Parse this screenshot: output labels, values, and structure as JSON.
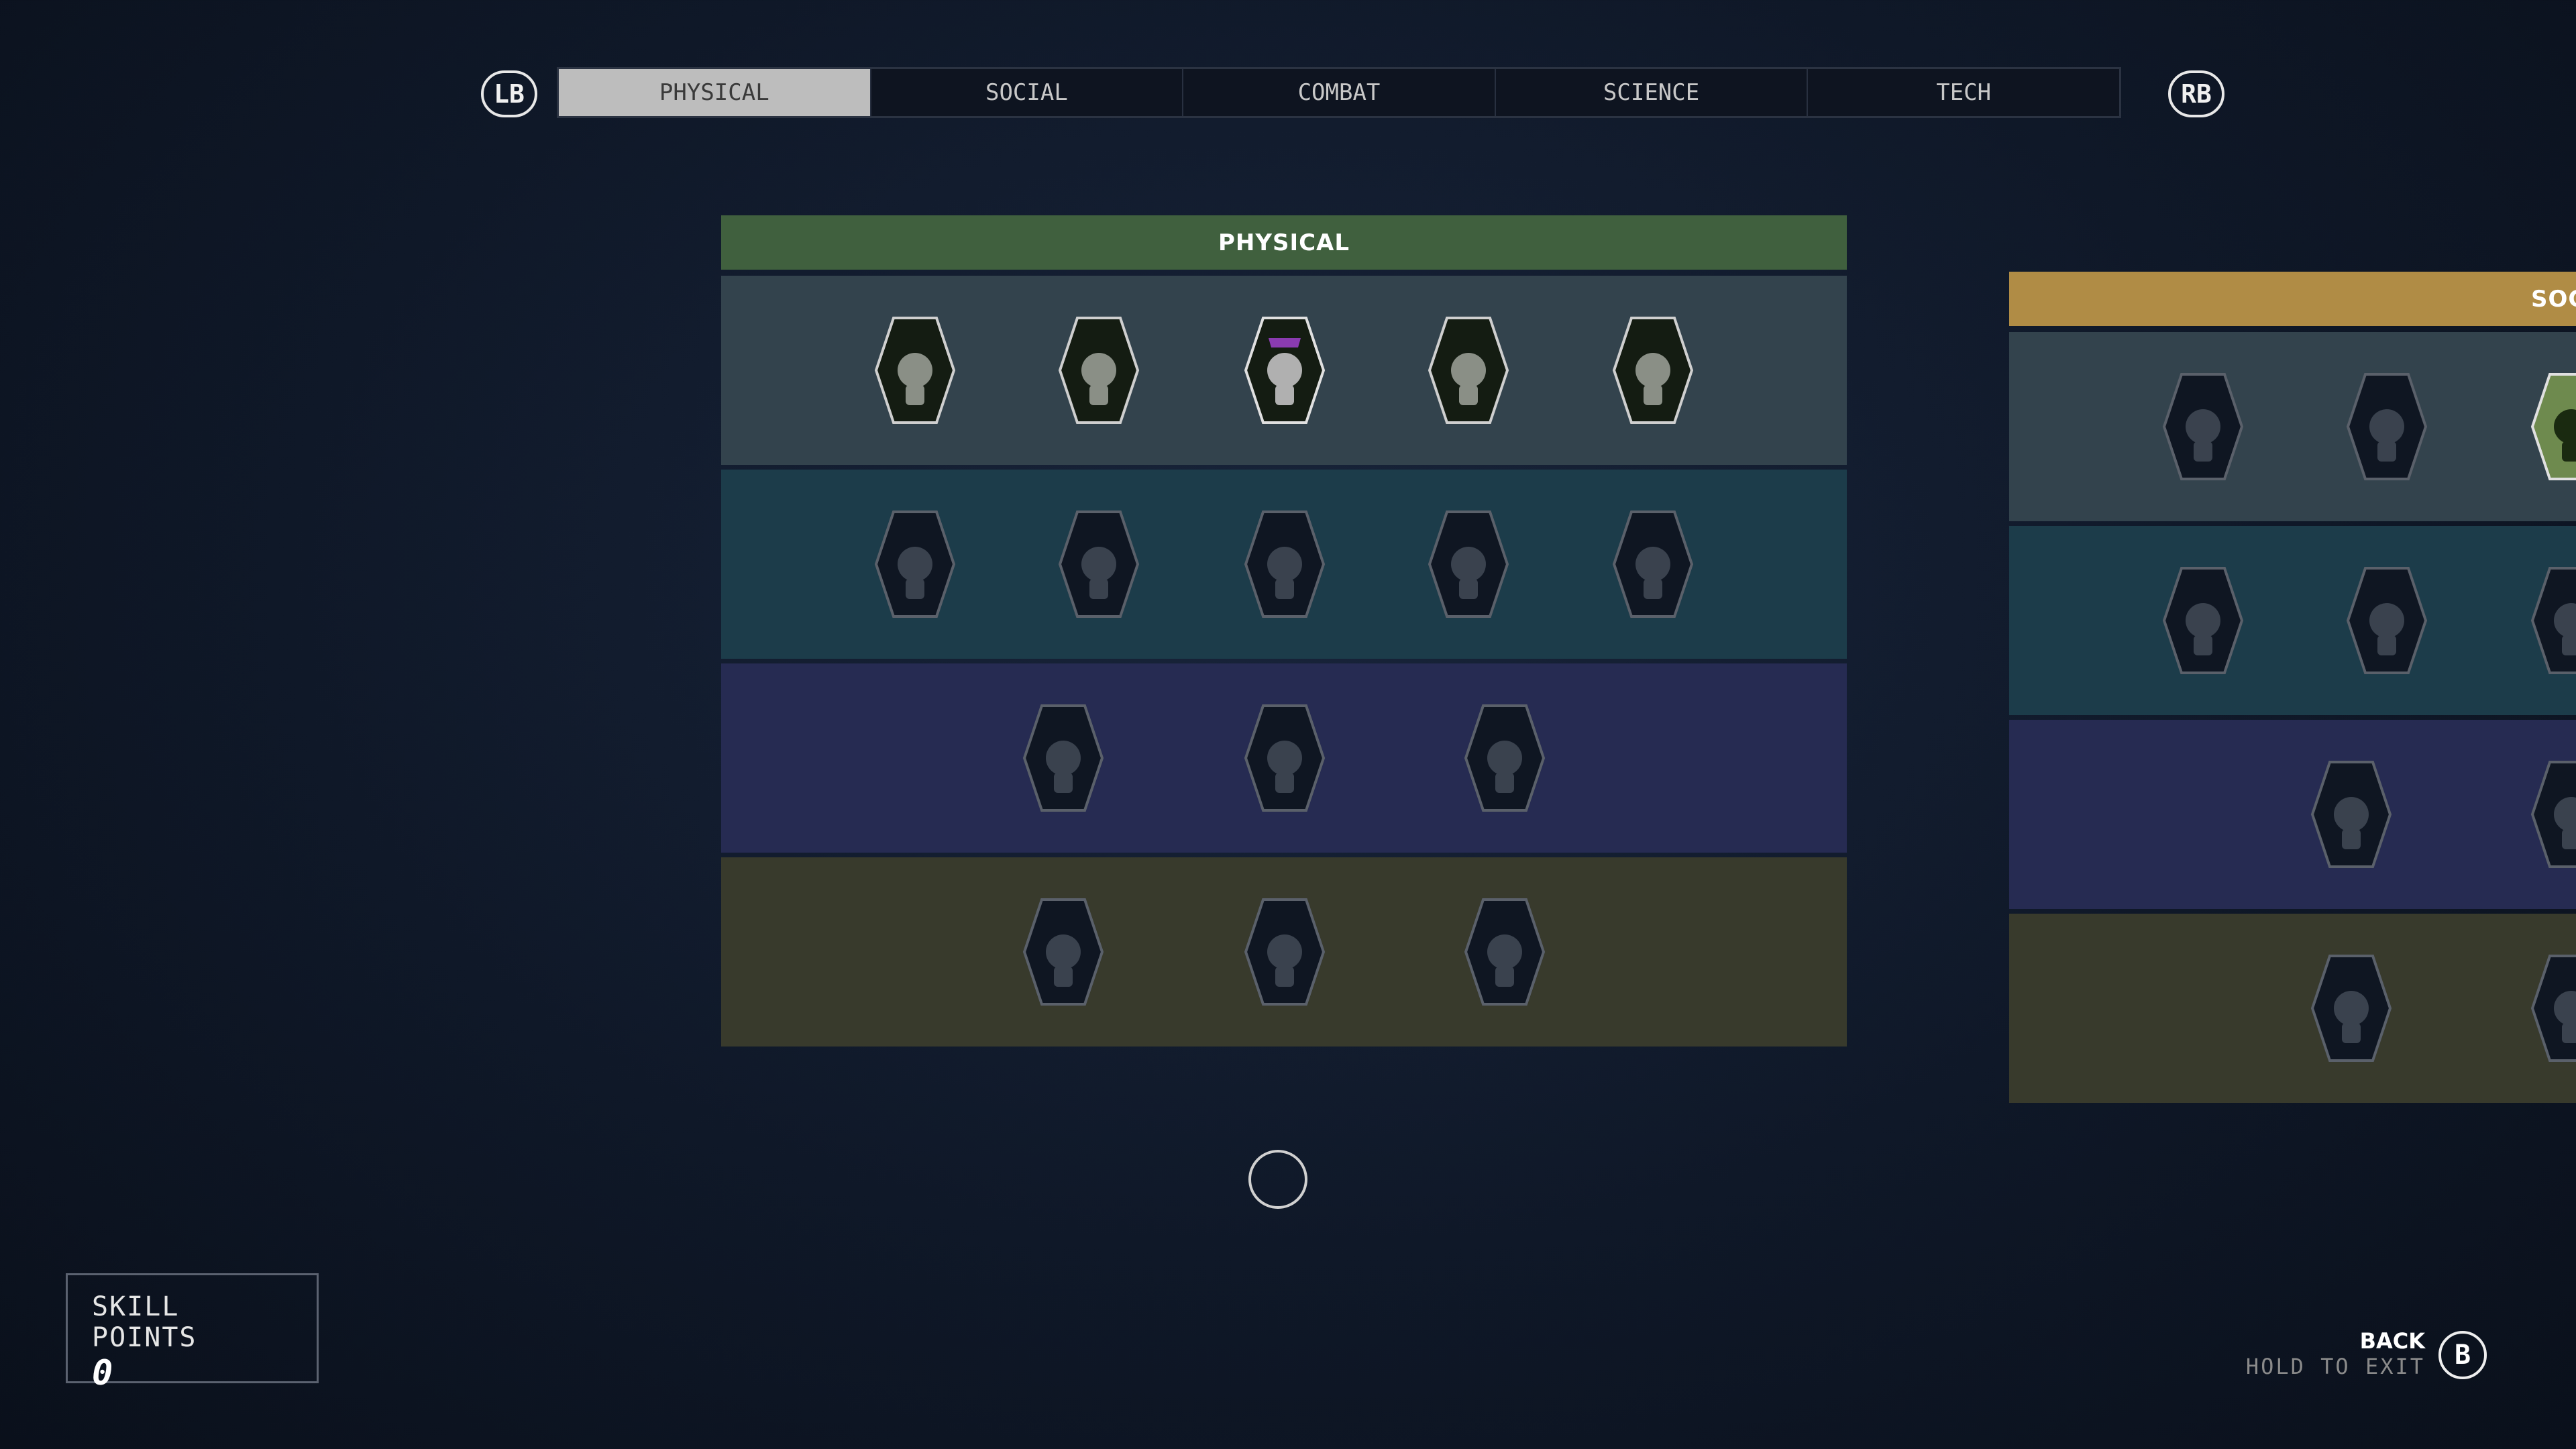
{
  "nav": {
    "prev_button": "LB",
    "next_button": "RB"
  },
  "tabs": [
    {
      "label": "PHYSICAL",
      "active": true
    },
    {
      "label": "SOCIAL",
      "active": false
    },
    {
      "label": "COMBAT",
      "active": false
    },
    {
      "label": "SCIENCE",
      "active": false
    },
    {
      "label": "TECH",
      "active": false
    }
  ],
  "panels": [
    {
      "title": "PHYSICAL",
      "header_color": "#40603e",
      "rows": [
        {
          "color": "#33434d",
          "skills": [
            {
              "icon": "fist-icon",
              "state": "unlocked"
            },
            {
              "icon": "crouching-figure-icon",
              "state": "unlocked"
            },
            {
              "icon": "masked-pistol-icon",
              "state": "highlighted"
            },
            {
              "icon": "dumbbell-icon",
              "state": "unlocked"
            },
            {
              "icon": "heart-medical-icon",
              "state": "unlocked"
            }
          ]
        },
        {
          "color": "#1c3c4a",
          "skills": [
            {
              "icon": "electric-figure-icon",
              "state": "locked"
            },
            {
              "icon": "backpack-hiker-icon",
              "state": "locked"
            },
            {
              "icon": "planet-leap-icon",
              "state": "locked"
            },
            {
              "icon": "hazard-triangle-icon",
              "state": "locked"
            },
            {
              "icon": "helmet-icon",
              "state": "locked"
            }
          ]
        },
        {
          "color": "#262b52",
          "skills": [
            {
              "icon": "meditation-icon",
              "state": "locked"
            },
            {
              "icon": "shield-emblem-icon",
              "state": "locked"
            },
            {
              "icon": "armored-fist-icon",
              "state": "locked"
            }
          ]
        },
        {
          "color": "#383a2c",
          "skills": [
            {
              "icon": "hooded-figure-icon",
              "state": "locked"
            },
            {
              "icon": "lightning-target-icon",
              "state": "locked"
            },
            {
              "icon": "flame-leaf-icon",
              "state": "locked"
            }
          ]
        }
      ]
    },
    {
      "title": "SOCIAL",
      "header_color": "#b08c45",
      "rows": [
        {
          "color": "#33434d",
          "skills": [
            {
              "icon": "hand-card-icon",
              "state": "locked"
            },
            {
              "icon": "hand-dish-icon",
              "state": "locked"
            },
            {
              "icon": "speaking-head-icon",
              "state": "highlighted-green"
            }
          ]
        },
        {
          "color": "#1c3c4a",
          "skills": [
            {
              "icon": "money-bag-gift-icon",
              "state": "locked"
            },
            {
              "icon": "handshake-icon",
              "state": "locked"
            },
            {
              "icon": "snarling-face-icon",
              "state": "locked"
            }
          ]
        },
        {
          "color": "#262b52",
          "skills": [
            {
              "icon": "people-match-icon",
              "state": "locked"
            },
            {
              "icon": "astronauts-icon",
              "state": "locked"
            }
          ]
        },
        {
          "color": "#383a2c",
          "skills": [
            {
              "icon": "puppet-strings-icon",
              "state": "locked"
            },
            {
              "icon": "workstation-icon",
              "state": "locked"
            }
          ]
        }
      ]
    }
  ],
  "skill_points": {
    "label": "SKILL POINTS",
    "value": "0"
  },
  "footer": {
    "back_label": "BACK",
    "hold_label": "HOLD TO EXIT",
    "button": "B"
  }
}
